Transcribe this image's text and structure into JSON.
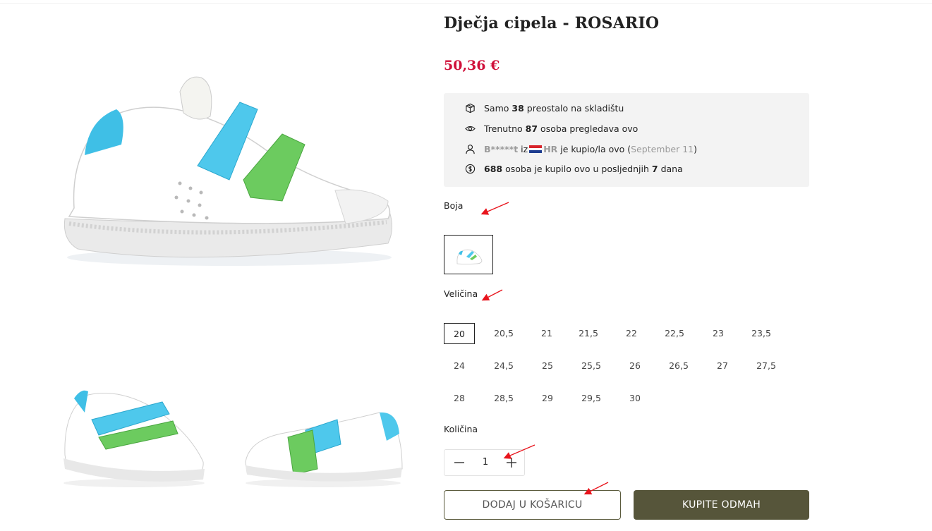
{
  "product": {
    "title": "Dječja cipela - ROSARIO",
    "price": "50,36 €"
  },
  "info": {
    "stock": {
      "prefix": "Samo",
      "count": "38",
      "suffix": "preostalo na skladištu"
    },
    "viewers": {
      "prefix": "Trenutno",
      "count": "87",
      "suffix": "osoba pregledava ovo"
    },
    "recent_buyer": {
      "name": "B*****t",
      "mid": "iz",
      "country": "HR",
      "action": "je kupio/la ovo (",
      "date": "September 11",
      "close": ")"
    },
    "sales": {
      "count": "688",
      "mid": "osoba je kupilo ovo u posljednjih",
      "days": "7",
      "suffix": "dana"
    }
  },
  "color": {
    "label": "Boja"
  },
  "size": {
    "label": "Veličina",
    "selected": "20",
    "options": [
      [
        "20",
        "20,5",
        "21",
        "21,5",
        "22",
        "22,5",
        "23",
        "23,5"
      ],
      [
        "24",
        "24,5",
        "25",
        "25,5",
        "26",
        "26,5",
        "27",
        "27,5"
      ],
      [
        "28",
        "28,5",
        "29",
        "29,5",
        "30"
      ]
    ]
  },
  "quantity": {
    "label": "Količina",
    "value": "1"
  },
  "buttons": {
    "add_to_cart": "DODAJ U KOŠARICU",
    "buy_now": "KUPITE ODMAH"
  },
  "icons": [
    "box-icon",
    "eye-icon",
    "user-icon",
    "coin-icon",
    "minus-icon",
    "plus-icon"
  ],
  "colors": {
    "price": "#d0103a",
    "buy_button": "#56553a",
    "info_box": "#f3f3f3",
    "annotation_arrow": "#e8141c"
  }
}
